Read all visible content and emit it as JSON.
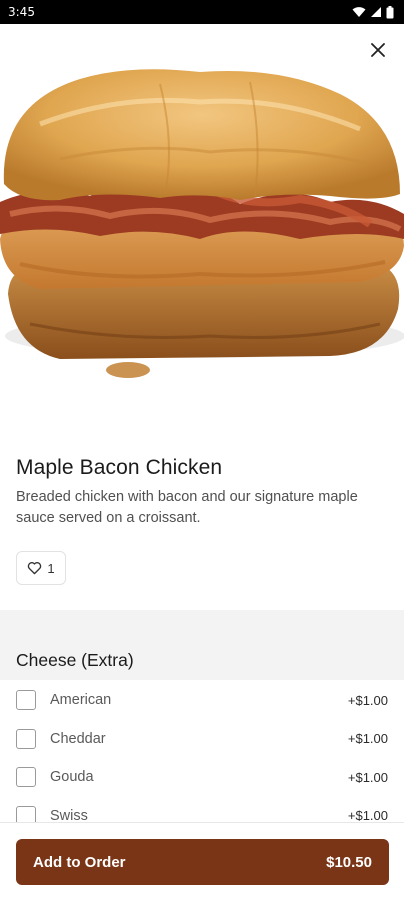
{
  "status_bar": {
    "time": "3:45"
  },
  "item": {
    "name": "Maple Bacon Chicken",
    "description": "Breaded chicken with bacon and our signature maple sauce served on a croissant.",
    "likes": "1"
  },
  "section": {
    "title": "Cheese (Extra)",
    "options": [
      {
        "label": "American",
        "price": "+$1.00"
      },
      {
        "label": "Cheddar",
        "price": "+$1.00"
      },
      {
        "label": "Gouda",
        "price": "+$1.00"
      },
      {
        "label": "Swiss",
        "price": "+$1.00"
      }
    ]
  },
  "footer": {
    "add_label": "Add to Order",
    "price": "$10.50"
  },
  "colors": {
    "accent": "#7a3517"
  }
}
